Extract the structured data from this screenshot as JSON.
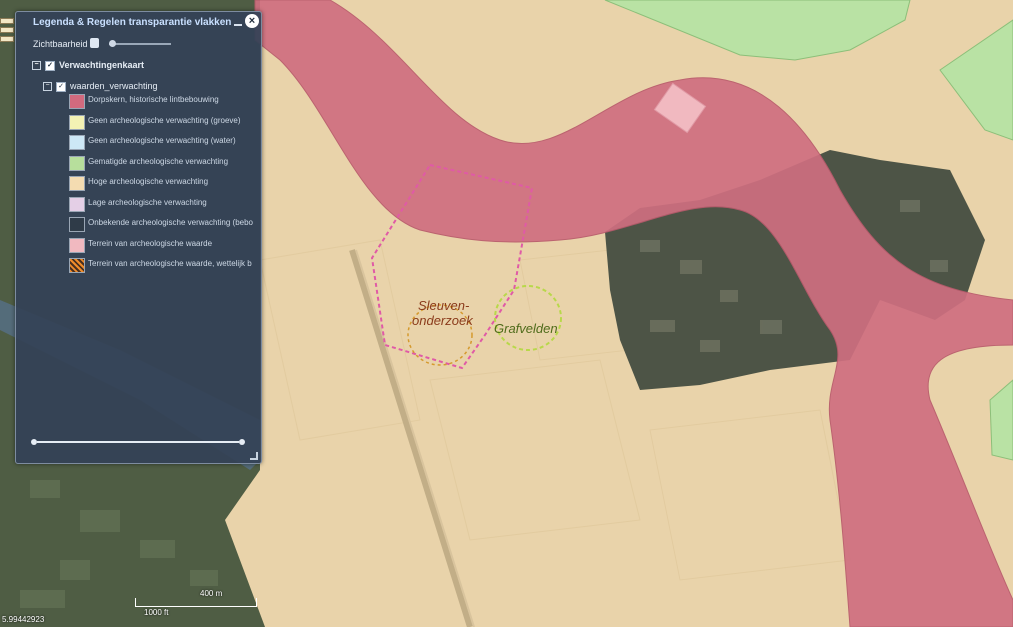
{
  "panel": {
    "title": "Legenda & Regelen transparantie vlakken",
    "close_symbol": "×",
    "opacity_label": "Zichtbaarheid",
    "opacity_value": 0.03
  },
  "layers": {
    "root": "Verwachtingenkaart",
    "sub": "waarden_verwachting",
    "items": [
      {
        "label": "Dorpskern, historische lintbebouwing",
        "color": "#d36a7e"
      },
      {
        "label": "Geen archeologische verwachting (groeve)",
        "color": "#f3f2b4"
      },
      {
        "label": "Geen archeologische verwachting (water)",
        "color": "#cde8f6"
      },
      {
        "label": "Gematigde archeologische verwachting",
        "color": "#b7df9c"
      },
      {
        "label": "Hoge archeologische verwachting",
        "color": "#f4dcb1"
      },
      {
        "label": "Lage archeologische verwachting",
        "color": "#e4cfe6"
      },
      {
        "label": "Onbekende archeologische verwachting (bebo",
        "color": "#2f3b48"
      },
      {
        "label": "Terrein van archeologische waarde",
        "color": "#f1b9c0"
      },
      {
        "label": "Terrein van archeologische waarde, wettelijk b",
        "color": "hatch"
      }
    ],
    "check_symbol": "✓",
    "expand_symbol": "−"
  },
  "map": {
    "label_sleuven_line1": "Sleuven-",
    "label_sleuven_line2": "onderzoek",
    "label_grafvelden": "Grafvelden",
    "scale_left": "1000 ft",
    "scale_right": "400 m",
    "coords": "5.99442923",
    "colors": {
      "base": "#e9d3aa",
      "dorpskern": "#cf6f80",
      "gematigd": "#b9e2a4",
      "sleuven": "#e05aa6",
      "grafvelden": "#b8d84a"
    }
  }
}
